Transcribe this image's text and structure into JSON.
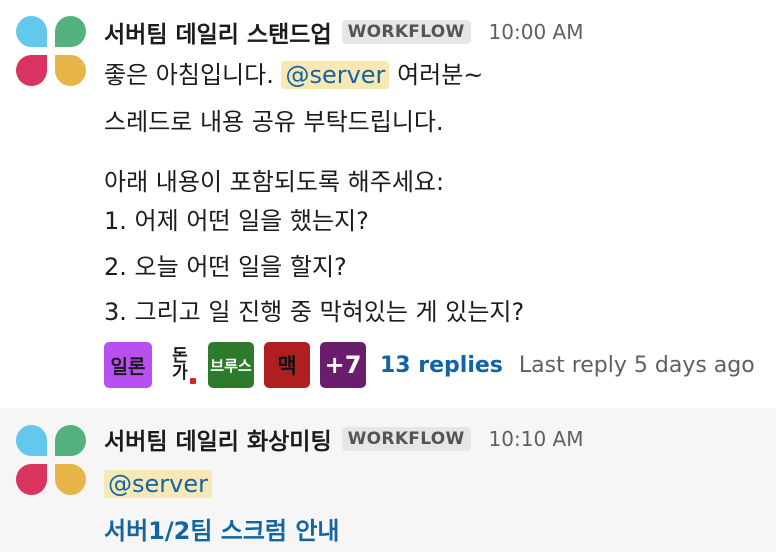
{
  "messages": [
    {
      "sender": "서버팀 데일리 스탠드업",
      "badge": "WORKFLOW",
      "time": "10:00 AM",
      "lines": {
        "greet_before": "좋은 아침입니다. ",
        "mention": "@server",
        "greet_after": " 여러분~",
        "line2": "스레드로 내용 공유 부탁드립니다.",
        "line3": "아래 내용이 포함되도록 해주세요:",
        "line4": "1. 어제 어떤 일을 했는지?",
        "line5": "2. 오늘 어떤 일을 할지?",
        "line6": "3. 그리고 일 진행 중 막혀있는 게 있는지?"
      },
      "reactions": [
        {
          "label": "일론",
          "icon": "custom-emoji-ilon"
        },
        {
          "label_top": "돈",
          "label_bottom": "가",
          "icon": "custom-emoji-donga"
        },
        {
          "label": "브루스",
          "icon": "custom-emoji-bruce"
        },
        {
          "label": "맥",
          "icon": "custom-emoji-mac"
        },
        {
          "label": "+7",
          "icon": "more-emoji-overflow"
        }
      ],
      "replies": "13 replies",
      "last_reply": "Last reply 5 days ago"
    },
    {
      "sender": "서버팀 데일리 화상미팅",
      "badge": "WORKFLOW",
      "time": "10:10 AM",
      "mention": "@server",
      "link": "서버1/2팀 스크럼 안내"
    }
  ],
  "colors": {
    "link": "#1264a3",
    "mention_bg": "#f8e8b5",
    "logo": [
      "#64c7ec",
      "#52b17d",
      "#d8345f",
      "#e8b548"
    ]
  }
}
